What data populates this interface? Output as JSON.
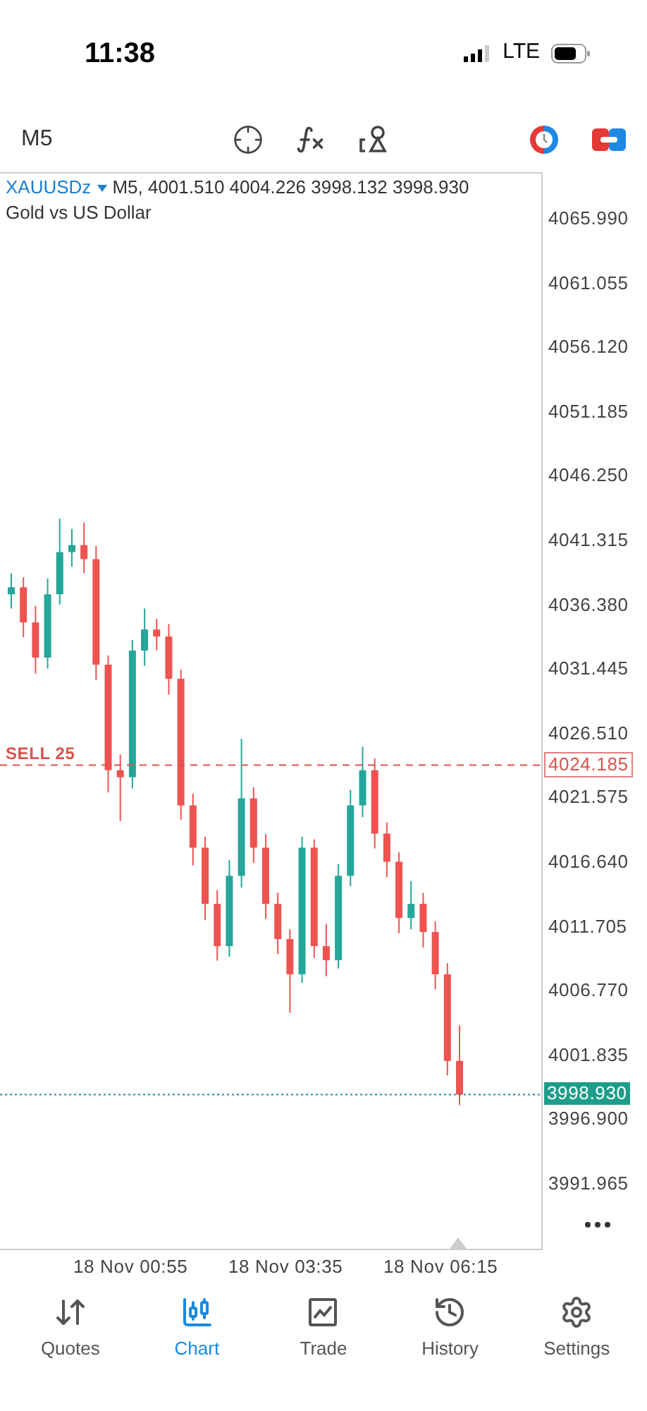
{
  "status_bar": {
    "time": "11:38",
    "network": "LTE"
  },
  "toolbar": {
    "timeframe": "M5"
  },
  "chart": {
    "symbol": "XAUUSDz",
    "quote": "M5, 4001.510 4004.226 3998.132 3998.930",
    "description": "Gold vs US Dollar",
    "order": {
      "label": "SELL 25"
    },
    "time_axis": [
      "18 Nov 00:55",
      "18 Nov 03:35",
      "18 Nov 06:15"
    ],
    "chart_data": {
      "type": "candlestick",
      "ylim": [
        3987.0,
        4069.44
      ],
      "ref_lines": [
        {
          "axis": "y",
          "value": 4024.185,
          "label": "4024.185",
          "color": "#d9534f"
        },
        {
          "axis": "y",
          "value": 3998.93,
          "label": "3998.930",
          "color": "#1a8aa0"
        }
      ],
      "yticks": [
        {
          "value": 4065.99,
          "label": "4065.990"
        },
        {
          "value": 4061.055,
          "label": "4061.055"
        },
        {
          "value": 4056.12,
          "label": "4056.120"
        },
        {
          "value": 4051.185,
          "label": "4051.185"
        },
        {
          "value": 4046.25,
          "label": "4046.250"
        },
        {
          "value": 4041.315,
          "label": "4041.315"
        },
        {
          "value": 4036.38,
          "label": "4036.380"
        },
        {
          "value": 4031.445,
          "label": "4031.445"
        },
        {
          "value": 4026.51,
          "label": "4026.510"
        },
        {
          "value": 4021.575,
          "label": "4021.575"
        },
        {
          "value": 4016.64,
          "label": "4016.640"
        },
        {
          "value": 4011.705,
          "label": "4011.705"
        },
        {
          "value": 4006.77,
          "label": "4006.770"
        },
        {
          "value": 4001.835,
          "label": "4001.835"
        },
        {
          "value": 3996.9,
          "label": "3996.900"
        },
        {
          "value": 3991.965,
          "label": "3991.965"
        }
      ],
      "categories": [
        null,
        null,
        null,
        null,
        null,
        null,
        null,
        null,
        null,
        null,
        null,
        null,
        null,
        null,
        null,
        null,
        null,
        null,
        null,
        null,
        null,
        null,
        null,
        null,
        null,
        null,
        null,
        null,
        null,
        null,
        null,
        null,
        null,
        null,
        null,
        null,
        null,
        null
      ],
      "ohlc": [
        [
          4037.29,
          4038.9,
          4036.2,
          4037.83
        ],
        [
          4037.83,
          4038.6,
          4034.0,
          4035.13
        ],
        [
          4035.13,
          4036.4,
          4031.2,
          4032.43
        ],
        [
          4032.43,
          4038.5,
          4031.6,
          4037.29
        ],
        [
          4037.29,
          4043.1,
          4036.5,
          4040.52
        ],
        [
          4040.52,
          4042.3,
          4039.4,
          4041.06
        ],
        [
          4041.06,
          4042.8,
          4038.9,
          4039.98
        ],
        [
          4039.98,
          4041.0,
          4030.7,
          4031.89
        ],
        [
          4031.89,
          4032.6,
          4022.1,
          4023.8
        ],
        [
          4023.8,
          4025.0,
          4019.9,
          4023.26
        ],
        [
          4023.26,
          4033.8,
          4022.4,
          4032.97
        ],
        [
          4032.97,
          4036.2,
          4031.8,
          4034.59
        ],
        [
          4034.59,
          4035.4,
          4033.0,
          4034.05
        ],
        [
          4034.05,
          4035.0,
          4029.6,
          4030.81
        ],
        [
          4030.81,
          4031.5,
          4020.0,
          4021.1
        ],
        [
          4021.1,
          4022.0,
          4016.5,
          4017.86
        ],
        [
          4017.86,
          4018.7,
          4012.3,
          4013.55
        ],
        [
          4013.55,
          4014.6,
          4009.2,
          4010.31
        ],
        [
          4010.31,
          4016.9,
          4009.5,
          4015.7
        ],
        [
          4015.7,
          4026.2,
          4014.8,
          4021.64
        ],
        [
          4021.64,
          4022.5,
          4016.7,
          4017.86
        ],
        [
          4017.86,
          4018.9,
          4012.4,
          4013.55
        ],
        [
          4013.55,
          4014.4,
          4009.7,
          4010.85
        ],
        [
          4010.85,
          4011.6,
          4005.2,
          4008.15
        ],
        [
          4008.15,
          4018.7,
          4007.5,
          4017.86
        ],
        [
          4017.86,
          4018.5,
          4009.4,
          4010.31
        ],
        [
          4010.31,
          4012.0,
          4008.0,
          4009.23
        ],
        [
          4009.23,
          4016.6,
          4008.6,
          4015.7
        ],
        [
          4015.7,
          4022.3,
          4014.9,
          4021.1
        ],
        [
          4021.1,
          4025.6,
          4020.2,
          4023.8
        ],
        [
          4023.8,
          4024.7,
          4017.8,
          4018.94
        ],
        [
          4018.94,
          4019.8,
          4015.6,
          4016.78
        ],
        [
          4016.78,
          4017.5,
          4011.3,
          4012.47
        ],
        [
          4012.47,
          4015.3,
          4011.6,
          4013.55
        ],
        [
          4013.55,
          4014.4,
          4010.2,
          4011.39
        ],
        [
          4011.39,
          4012.2,
          4007.0,
          4008.15
        ],
        [
          4008.15,
          4009.0,
          4000.4,
          4001.51
        ],
        [
          4001.51,
          4004.226,
          3998.132,
          3998.93
        ]
      ]
    }
  },
  "tabs": [
    {
      "label": "Quotes",
      "selected": false
    },
    {
      "label": "Chart",
      "selected": true
    },
    {
      "label": "Trade",
      "selected": false
    },
    {
      "label": "History",
      "selected": false
    },
    {
      "label": "Settings",
      "selected": false
    }
  ]
}
